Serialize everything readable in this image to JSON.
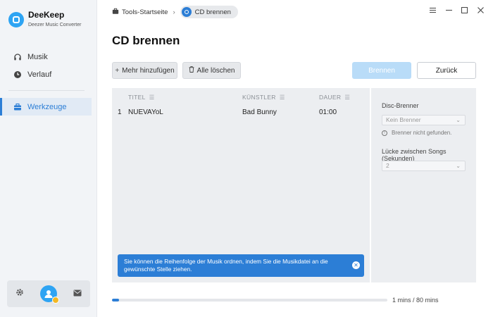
{
  "app": {
    "name": "DeeKeep",
    "subtitle": "Deezer Music Converter"
  },
  "sidebar": {
    "items": [
      {
        "label": "Musik",
        "icon": "headphones-icon"
      },
      {
        "label": "Verlauf",
        "icon": "clock-icon"
      },
      {
        "label": "Werkzeuge",
        "icon": "toolbox-icon",
        "active": true
      }
    ],
    "bottom": [
      "gear-icon",
      "avatar",
      "mail-icon"
    ]
  },
  "header": {
    "breadcrumb_home": "Tools-Startseite",
    "breadcrumb_current": "CD brennen",
    "window_controls": [
      "menu-icon",
      "minimize-icon",
      "maximize-icon",
      "close-icon"
    ]
  },
  "page": {
    "title": "CD brennen"
  },
  "toolbar": {
    "add_more": "Mehr hinzufügen",
    "delete_all": "Alle löschen",
    "burn": "Brennen",
    "back": "Zurück"
  },
  "table": {
    "columns": [
      "TITEL",
      "KÜNSTLER",
      "DAUER"
    ],
    "rows": [
      {
        "index": "1",
        "title": "NUEVAYoL",
        "artist": "Bad Bunny",
        "duration": "01:00"
      }
    ]
  },
  "tip": {
    "text": "Sie können die Reihenfolge der Musik ordnen, indem Sie die Musikdatei an die gewünschte Stelle ziehen."
  },
  "settings": {
    "disc_burner_label": "Disc-Brenner",
    "disc_burner_value": "Kein Brenner",
    "burner_hint": "Brenner nicht gefunden.",
    "gap_label": "Lücke zwischen Songs (Sekunden)",
    "gap_value": "2"
  },
  "progress": {
    "fraction": 0.025,
    "text": "1 mins / 80 mins"
  },
  "colors": {
    "accent": "#2c7ed6",
    "primary_disabled": "#b9dcf8",
    "sidebar_bg": "#f2f4f7"
  }
}
